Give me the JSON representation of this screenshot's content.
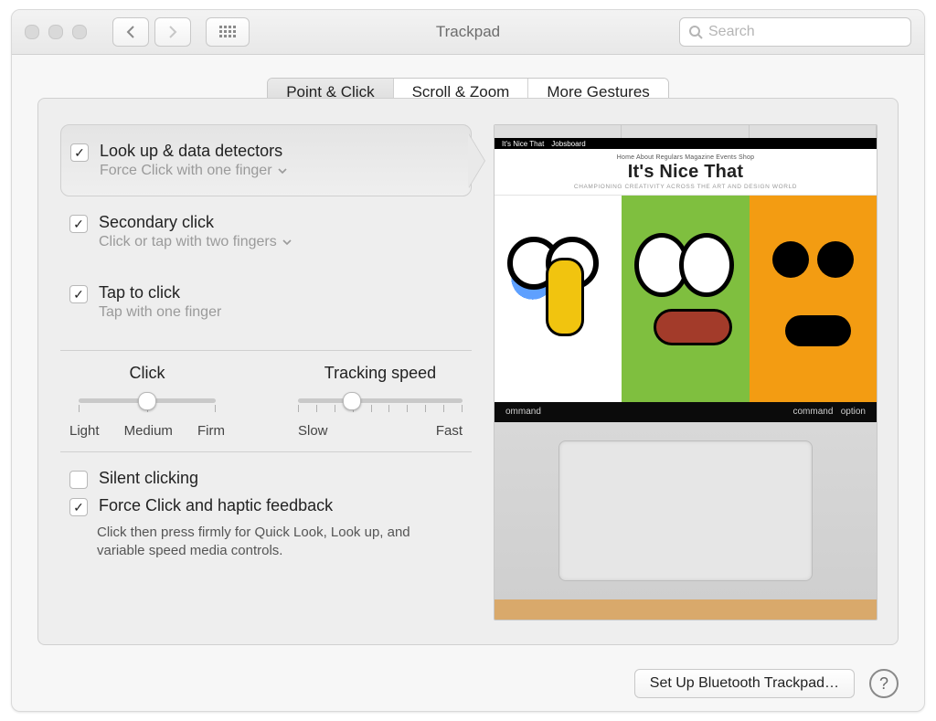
{
  "window": {
    "title": "Trackpad"
  },
  "search": {
    "placeholder": "Search"
  },
  "tabs": {
    "t0": "Point & Click",
    "t1": "Scroll & Zoom",
    "t2": "More Gestures",
    "active": 0
  },
  "options": {
    "lookup": {
      "title": "Look up & data detectors",
      "sub": "Force Click with one finger",
      "checked": true,
      "dropdown": true
    },
    "secondary": {
      "title": "Secondary click",
      "sub": "Click or tap with two fingers",
      "checked": true,
      "dropdown": true
    },
    "tap": {
      "title": "Tap to click",
      "sub": "Tap with one finger",
      "checked": true,
      "dropdown": false
    }
  },
  "sliders": {
    "click": {
      "name": "Click",
      "scaleLeft": "Light",
      "scaleMid": "Medium",
      "scaleRight": "Firm",
      "ticks": 3,
      "valuePct": 50
    },
    "tracking": {
      "name": "Tracking speed",
      "scaleLeft": "Slow",
      "scaleRight": "Fast",
      "ticks": 10,
      "valuePct": 33
    }
  },
  "bottomOptions": {
    "silent": {
      "label": "Silent clicking",
      "checked": false
    },
    "force": {
      "label": "Force Click and haptic feedback",
      "checked": true,
      "desc": "Click then press firmly for Quick Look, Look up, and variable speed media controls."
    }
  },
  "preview": {
    "siteMenu": "Home  About  Regulars  Magazine  Events  Shop",
    "siteLogo": "It's Nice That",
    "siteSub": "CHAMPIONING CREATIVITY ACROSS THE ART AND DESIGN WORLD",
    "keyLeft": "ommand",
    "keyRight1": "command",
    "keyRight2": "option"
  },
  "footer": {
    "bluetooth": "Set Up Bluetooth Trackpad…"
  }
}
